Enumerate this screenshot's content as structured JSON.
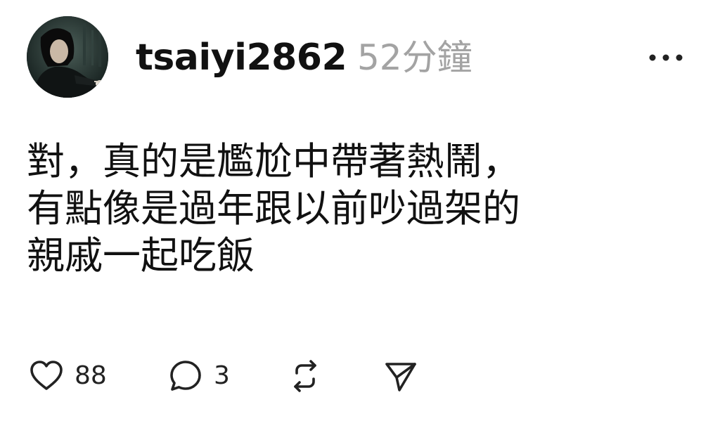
{
  "post": {
    "username": "tsaiyi2862",
    "timestamp": "52分鐘",
    "body_lines": [
      "對，真的是尷尬中帶著熱鬧，",
      "有點像是過年跟以前吵過架的",
      "親戚一起吃飯"
    ],
    "like_count": "88",
    "comment_count": "3"
  },
  "icons": {
    "more": "more-horizontal-icon",
    "like": "heart-icon",
    "comment": "comment-bubble-icon",
    "repost": "repost-icon",
    "share": "send-icon"
  },
  "colors": {
    "text": "#111111",
    "muted": "#a3a3a3",
    "background": "#ffffff"
  }
}
